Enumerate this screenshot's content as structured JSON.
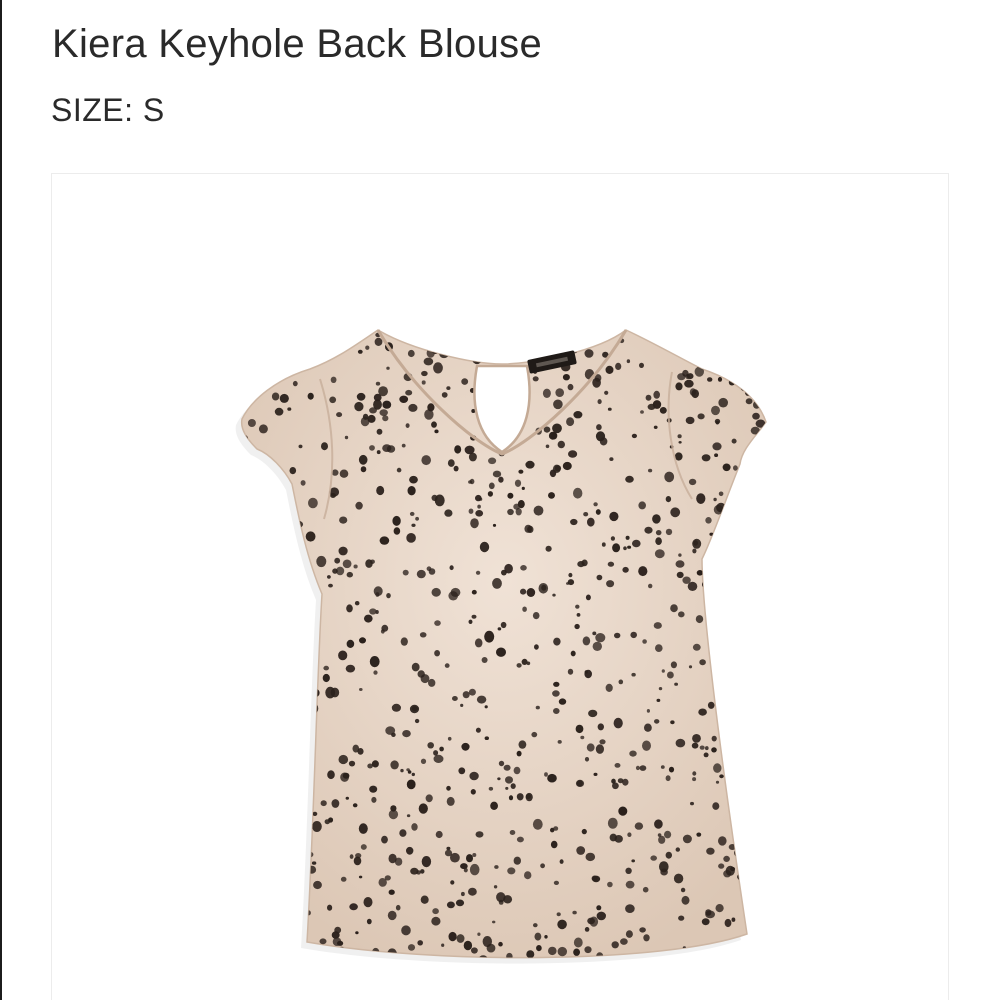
{
  "product": {
    "title": "Kiera Keyhole Back Blouse",
    "size_label": "SIZE:",
    "size_value": "S"
  },
  "image": {
    "icon": "blouse-photo",
    "fabric_color": "#e8d7c8",
    "dot_color": "#2b211c"
  }
}
